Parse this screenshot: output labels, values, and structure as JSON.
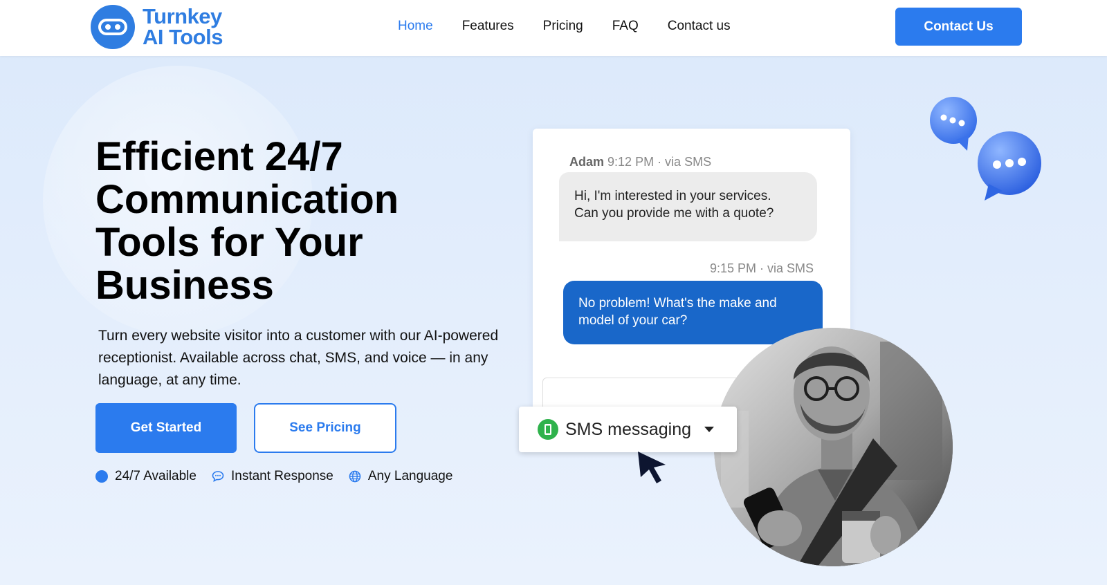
{
  "brand": {
    "name_line1": "Turnkey",
    "name_line2": "AI Tools",
    "color": "#2f7de1"
  },
  "nav": {
    "items": [
      "Home",
      "Features",
      "Pricing",
      "FAQ",
      "Contact us"
    ],
    "active": "Home",
    "cta": "Contact Us"
  },
  "hero": {
    "title": "Efficient 24/7 Communication Tools for Your Business",
    "subtitle": "Turn every website visitor into a customer with our AI-powered receptionist. Available across chat, SMS, and voice — in any language, at any time.",
    "primary_button": "Get Started",
    "secondary_button": "See Pricing",
    "features": [
      "24/7 Available",
      "Instant Response",
      "Any Language"
    ]
  },
  "chat": {
    "incoming": {
      "sender": "Adam",
      "meta": "9:12 PM · via SMS",
      "text_line1": "Hi, I'm interested in your services.",
      "text_line2": "Can you provide me with a quote?"
    },
    "outgoing": {
      "meta": "9:15 PM · via SMS",
      "text_line1": "No problem! What's the make and",
      "text_line2": "model of your car?"
    },
    "channel_select": "SMS messaging"
  },
  "colors": {
    "accent": "#2b7bee",
    "outgoing_bubble": "#1967c9",
    "incoming_bubble": "#ececec",
    "sms_green": "#2fb24c"
  }
}
